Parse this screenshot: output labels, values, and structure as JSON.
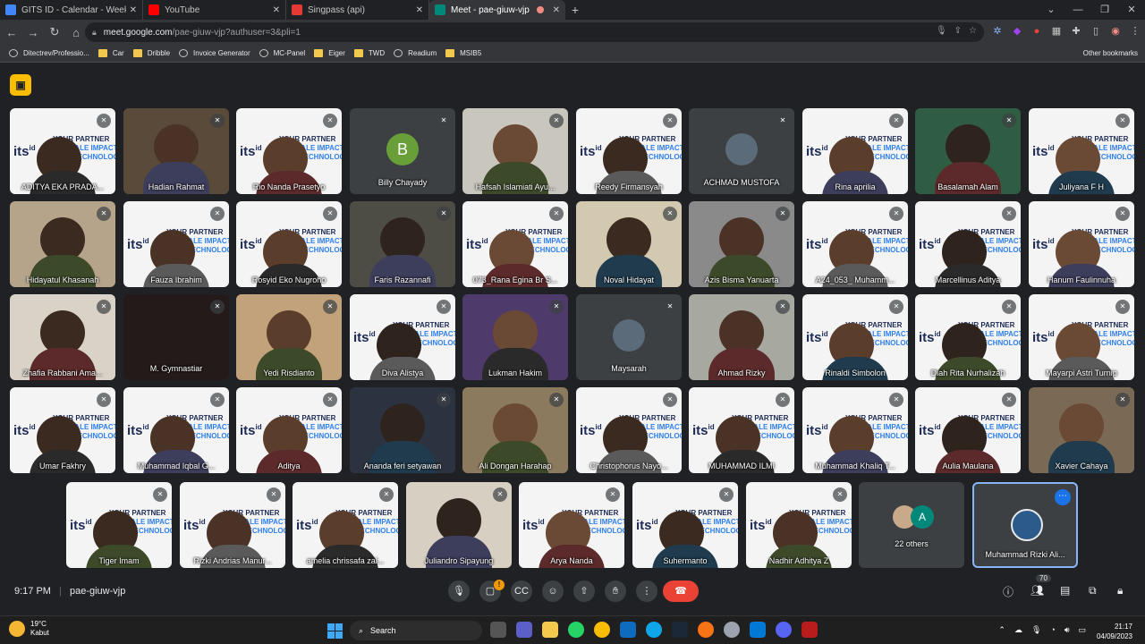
{
  "tabs": [
    {
      "label": "GITS ID - Calendar - Week of Sep",
      "color": "#4285f4"
    },
    {
      "label": "YouTube",
      "color": "#ff0000"
    },
    {
      "label": "Singpass (api)",
      "color": "#e53935"
    },
    {
      "label": "Meet - pae-giuw-vjp",
      "color": "#00897b"
    }
  ],
  "url": {
    "host": "meet.google.com",
    "path": "/pae-giuw-vjp?authuser=3&pli=1"
  },
  "bookmarks": [
    {
      "label": "Ditectrev/Professio...",
      "icon": "github-icon"
    },
    {
      "label": "Car",
      "icon": "folder-icon"
    },
    {
      "label": "Dribble",
      "icon": "folder-icon"
    },
    {
      "label": "Invoice Generator",
      "icon": "globe-icon"
    },
    {
      "label": "MC-Panel",
      "icon": "globe-icon"
    },
    {
      "label": "Eiger",
      "icon": "folder-icon"
    },
    {
      "label": "TWD",
      "icon": "folder-icon"
    },
    {
      "label": "Readium",
      "icon": "globe-icon"
    },
    {
      "label": "MSIB5",
      "icon": "folder-icon"
    }
  ],
  "other_bookmarks": "Other bookmarks",
  "promo": {
    "brand": "its",
    "sup": "id",
    "l1": "YOUR PARTNER",
    "l2": "TO SCALE IMPACT",
    "l3": "WITH TECHNOLOGY"
  },
  "tiles": [
    {
      "name": "ADITYA EKA PRADA...",
      "kind": "promo"
    },
    {
      "name": "Hadian Rahmat",
      "kind": "cam",
      "bg": "#5a4a3a"
    },
    {
      "name": "Rio Nanda Prasetyo",
      "kind": "promo"
    },
    {
      "name": "Billy Chayady",
      "kind": "avatar",
      "letter": "B",
      "color": "#689f38"
    },
    {
      "name": "Hafsah Islamiati Ayu...",
      "kind": "cam",
      "bg": "#c9c6bd"
    },
    {
      "name": "Reedy Firmansyah",
      "kind": "promo"
    },
    {
      "name": "ACHMAD MUSTOFA",
      "kind": "photo"
    },
    {
      "name": "Rina aprilia",
      "kind": "promo"
    },
    {
      "name": "Basalamah Alam",
      "kind": "cam",
      "bg": "#2f5d43"
    },
    {
      "name": "Juliyana F H",
      "kind": "promo"
    },
    {
      "name": "Hidayatul Khasanah",
      "kind": "cam",
      "bg": "#b5a48a"
    },
    {
      "name": "Fauza Ibrahim",
      "kind": "promo"
    },
    {
      "name": "Rosyid Eko Nugroho",
      "kind": "promo"
    },
    {
      "name": "Faris Razannafi",
      "kind": "cam",
      "bg": "#4d4c45"
    },
    {
      "name": "073_Rana Egina Br S...",
      "kind": "promo"
    },
    {
      "name": "Noval Hidayat",
      "kind": "cam",
      "bg": "#d3c8b0"
    },
    {
      "name": "Azis Bisma Yanuarta",
      "kind": "cam",
      "bg": "#8a8a8a"
    },
    {
      "name": "A24_053_ Muhamm...",
      "kind": "promo"
    },
    {
      "name": "Marcellinus Aditya",
      "kind": "promo"
    },
    {
      "name": "Hanum Faulinnuha",
      "kind": "promo"
    },
    {
      "name": "Zhafia Rabbani Ama...",
      "kind": "cam",
      "bg": "#d9d2c6"
    },
    {
      "name": "M. Gymnastiar",
      "kind": "dark"
    },
    {
      "name": "Yedi Risdianto",
      "kind": "cam",
      "bg": "#c2a27a"
    },
    {
      "name": "Diva Alistya",
      "kind": "promo"
    },
    {
      "name": "Lukman Hakim",
      "kind": "cam",
      "bg": "#4e3b6b"
    },
    {
      "name": "Maysarah",
      "kind": "photo"
    },
    {
      "name": "Ahmad Rizky",
      "kind": "cam",
      "bg": "#a7a9a1"
    },
    {
      "name": "Rinaldi Simbolon",
      "kind": "promo"
    },
    {
      "name": "Diah Rita Nurhalizah",
      "kind": "promo"
    },
    {
      "name": "Mayarpi Astri Turnip",
      "kind": "promo"
    },
    {
      "name": "Umar Fakhry",
      "kind": "promo"
    },
    {
      "name": "Muhammad Iqbal G...",
      "kind": "promo"
    },
    {
      "name": "Aditya",
      "kind": "promo"
    },
    {
      "name": "Ananda feri setyawan",
      "kind": "cam",
      "bg": "#2c3340"
    },
    {
      "name": "Ali Dongan Harahap",
      "kind": "cam",
      "bg": "#8c7a5e"
    },
    {
      "name": "Christophorus Nayo...",
      "kind": "promo"
    },
    {
      "name": "MUHAMMAD ILMI",
      "kind": "promo"
    },
    {
      "name": "Muhammad Khaliq T...",
      "kind": "promo"
    },
    {
      "name": "Aulia Maulana",
      "kind": "promo"
    },
    {
      "name": "Xavier Cahaya",
      "kind": "cam",
      "bg": "#7a6a55"
    },
    {
      "name": "Tiger Imam",
      "kind": "promo"
    },
    {
      "name": "Rizki Andrias Manur...",
      "kind": "promo"
    },
    {
      "name": "amelia chrissafa zal...",
      "kind": "promo"
    },
    {
      "name": "Juliandro Sipayung",
      "kind": "cam",
      "bg": "#d6cfc2"
    },
    {
      "name": "Arya Nanda",
      "kind": "promo"
    },
    {
      "name": "Suhermanto",
      "kind": "promo"
    },
    {
      "name": "Nadhir Adhitya Z",
      "kind": "promo"
    },
    {
      "name": "22 others",
      "kind": "others",
      "letter": "A"
    },
    {
      "name": "Muhammad Rizki Ali...",
      "kind": "self"
    }
  ],
  "meeting": {
    "time": "9:17 PM",
    "code": "pae-giuw-vjp",
    "participants": "70",
    "warning": "!"
  },
  "taskbar": {
    "temp": "19°C",
    "weather": "Kabut",
    "search": "Search",
    "time": "21:17",
    "date": "04/09/2023"
  }
}
